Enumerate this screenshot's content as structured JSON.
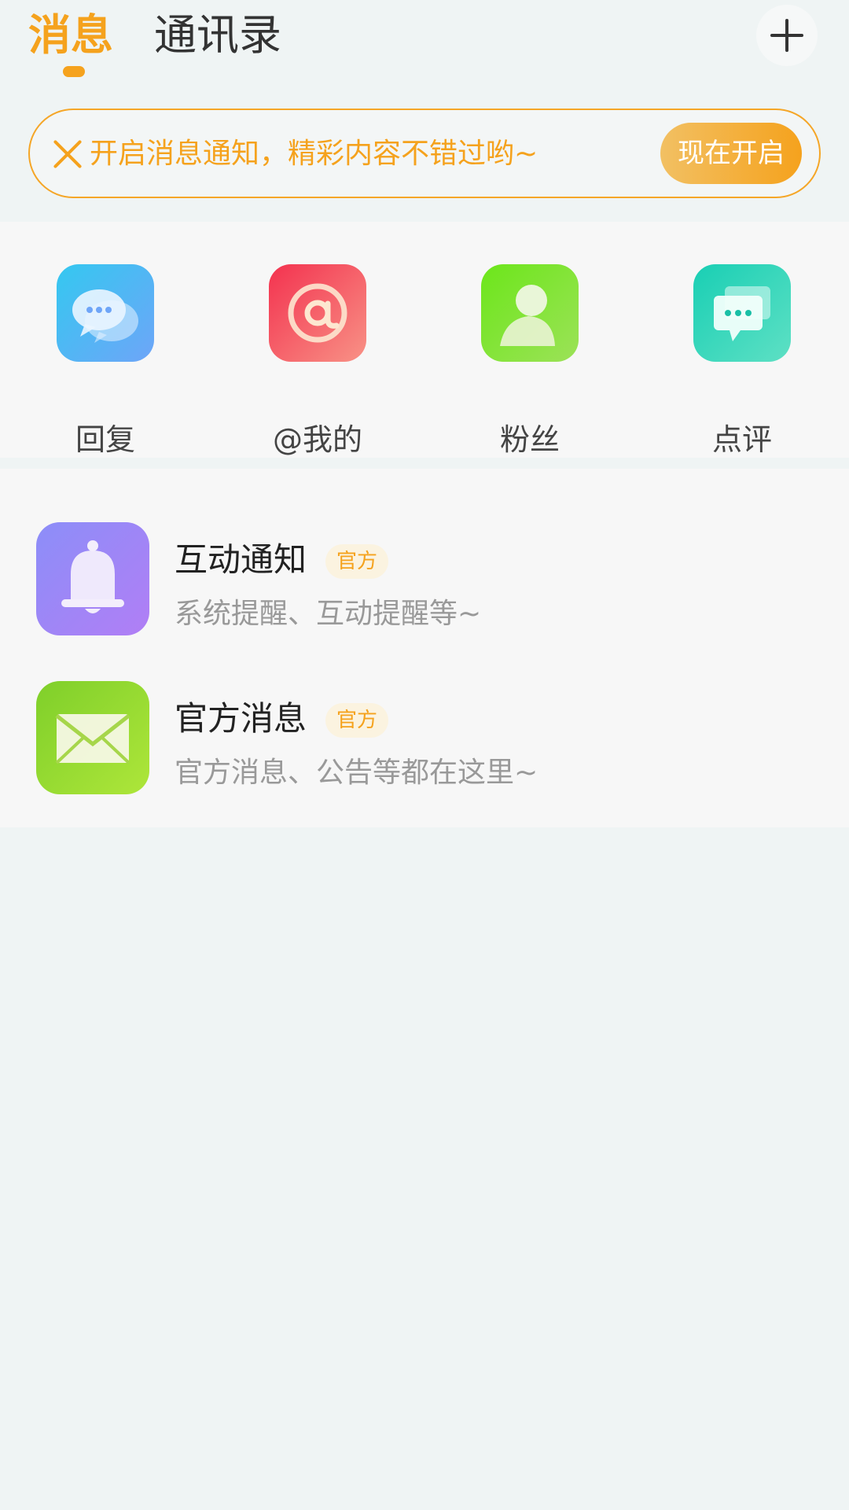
{
  "header": {
    "tabs": [
      {
        "label": "消息",
        "active": true
      },
      {
        "label": "通讯录",
        "active": false
      }
    ],
    "add_icon": "plus-icon"
  },
  "banner": {
    "close_icon": "close-icon",
    "text": "开启消息通知，精彩内容不错过哟~",
    "button_label": "现在开启"
  },
  "quick_entries": [
    {
      "label": "回复",
      "icon": "chat-bubble-icon",
      "color": "#34c8f0"
    },
    {
      "label": "@我的",
      "icon": "at-sign-icon",
      "color": "#f3324f"
    },
    {
      "label": "粉丝",
      "icon": "person-icon",
      "color": "#6ce61a"
    },
    {
      "label": "点评",
      "icon": "comment-icon",
      "color": "#19cfb4"
    }
  ],
  "messages": [
    {
      "title": "互动通知",
      "badge": "官方",
      "description": "系统提醒、互动提醒等~",
      "icon": "bell-icon"
    },
    {
      "title": "官方消息",
      "badge": "官方",
      "description": "官方消息、公告等都在这里~",
      "icon": "envelope-icon"
    }
  ],
  "colors": {
    "accent": "#f5a21d",
    "background": "#eff4f4"
  }
}
